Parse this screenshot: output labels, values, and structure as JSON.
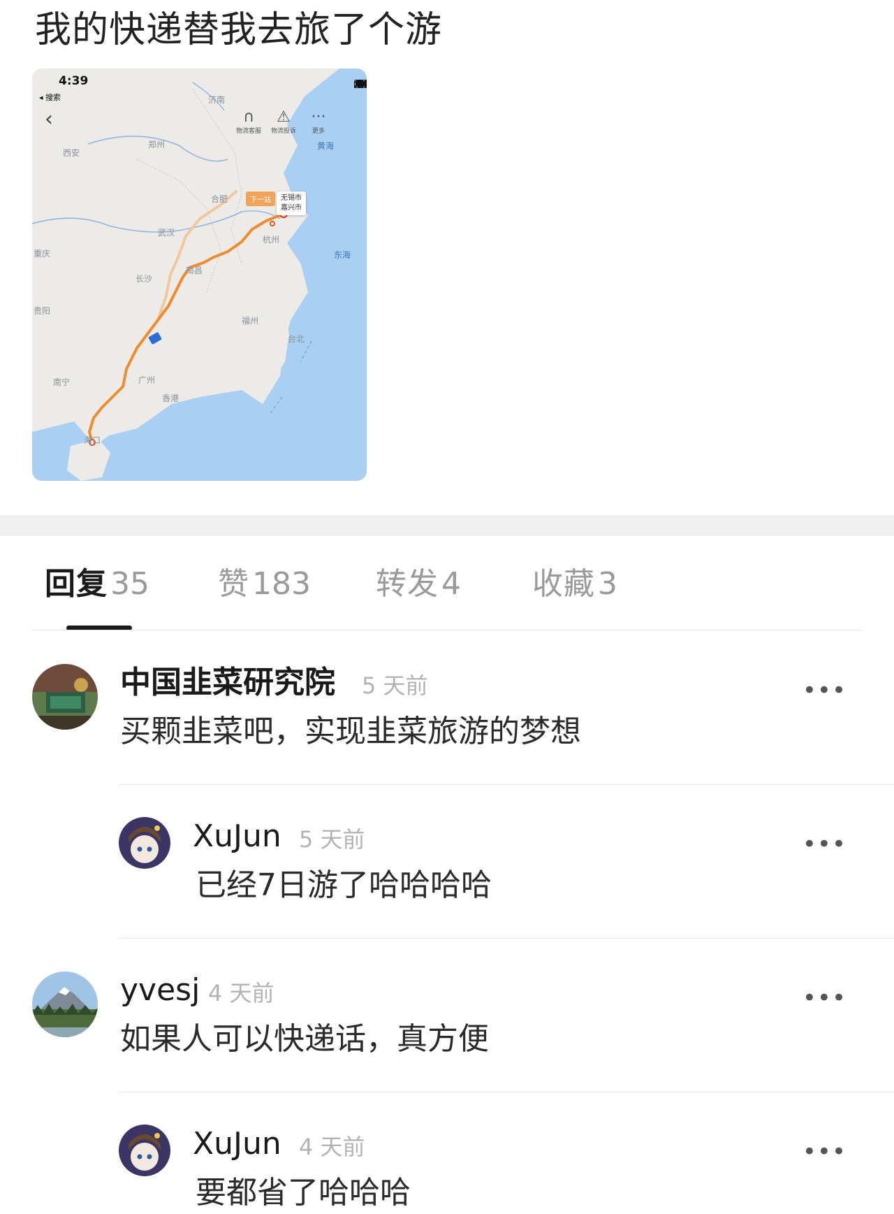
{
  "post": {
    "title": "我的快递替我去旅了个游"
  },
  "embedded_screenshot": {
    "status_time": "4:39",
    "status_back": "◂ 搜索",
    "toolbar": [
      {
        "icon": "headset-icon",
        "label": "物流客服"
      },
      {
        "icon": "warning-icon",
        "label": "物流投诉"
      },
      {
        "icon": "more-icon",
        "label": "更多"
      }
    ],
    "callout_next": "下一站",
    "callout_city_1": "无锡市",
    "callout_city_2": "嘉兴市",
    "cities": {
      "jinan": "济南",
      "xian": "西安",
      "zhengzhou": "郑州",
      "hefei": "合肥",
      "wuhan": "武汉",
      "chongqing": "重庆",
      "nanchang": "南昌",
      "changsha": "长沙",
      "hangzhou": "杭州",
      "fuzhou": "福州",
      "guiyang": "贵阳",
      "taibei": "台北",
      "nanning": "南宁",
      "guangzhou": "广州",
      "hongkong": "香港",
      "haikou": "海口"
    },
    "seas": {
      "huanghai": "黄海",
      "donghai": "东海"
    },
    "route_color": "#f08c2e"
  },
  "tabs": [
    {
      "label": "回复",
      "count": "35",
      "active": true
    },
    {
      "label": "赞",
      "count": "183",
      "active": false
    },
    {
      "label": "转发",
      "count": "4",
      "active": false
    },
    {
      "label": "收藏",
      "count": "3",
      "active": false
    }
  ],
  "comments": [
    {
      "name": "中国韭菜研究院",
      "time": "5 天前",
      "text": "买颗韭菜吧，实现韭菜旅游的梦想",
      "more": "•••"
    },
    {
      "name": "XuJun",
      "time": "5 天前",
      "text": "已经7日游了哈哈哈哈",
      "more": "•••"
    },
    {
      "name": "yvesj",
      "time": "4 天前",
      "text": "如果人可以快递话，真方便",
      "more": "•••"
    },
    {
      "name": "XuJun",
      "time": "4 天前",
      "text": "要都省了哈哈哈",
      "more": "•••"
    }
  ]
}
